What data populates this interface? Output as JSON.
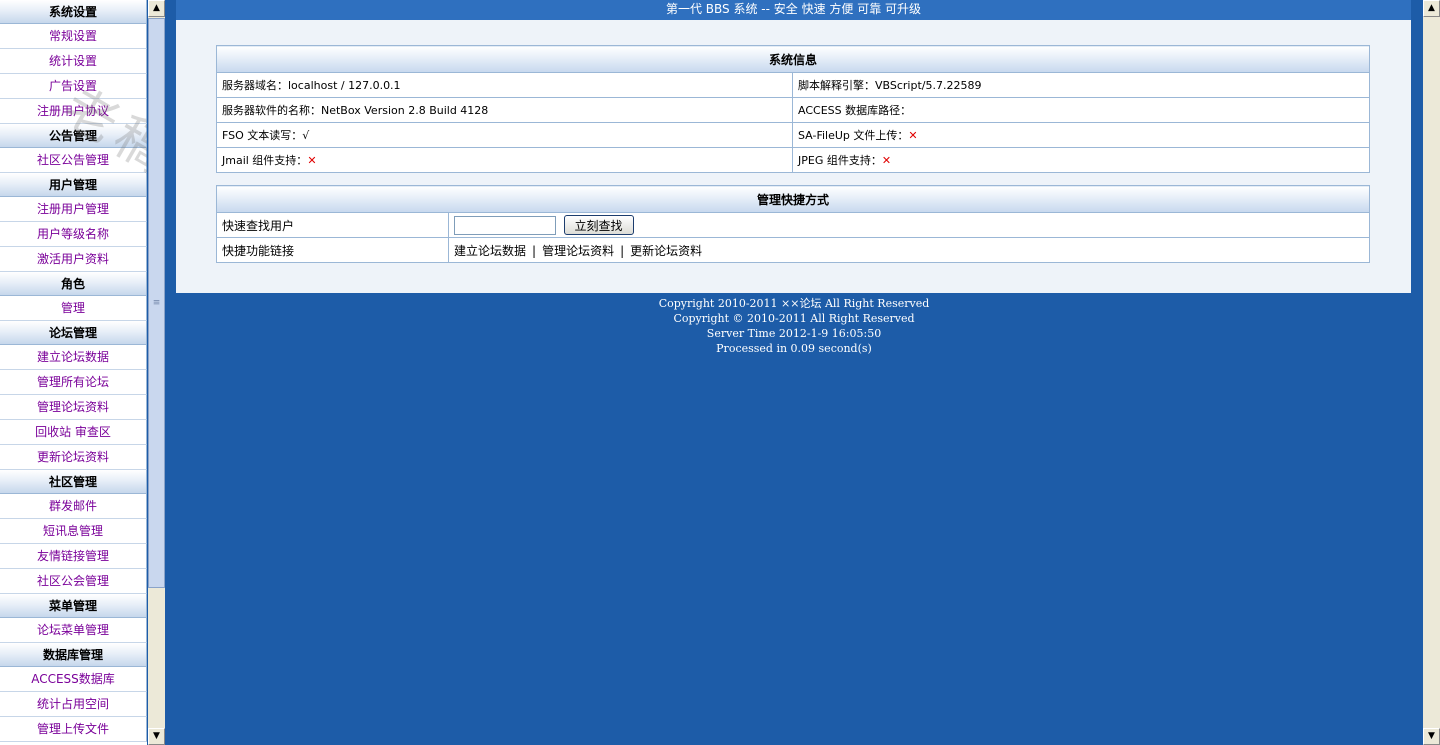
{
  "sidebar": {
    "sections": [
      {
        "title": "系统设置",
        "items": [
          "常规设置",
          "统计设置",
          "广告设置",
          "注册用户协议"
        ]
      },
      {
        "title": "公告管理",
        "items": [
          "社区公告管理"
        ]
      },
      {
        "title": "用户管理",
        "items": [
          "注册用户管理",
          "用户等级名称",
          "激活用户资料"
        ]
      },
      {
        "title": "角色",
        "items": [
          "管理"
        ]
      },
      {
        "title": "论坛管理",
        "items": [
          "建立论坛数据",
          "管理所有论坛",
          "管理论坛资料",
          "回收站 审查区",
          "更新论坛资料"
        ]
      },
      {
        "title": "社区管理",
        "items": [
          "群发邮件",
          "短讯息管理",
          "友情链接管理",
          "社区公会管理"
        ]
      },
      {
        "title": "菜单管理",
        "items": [
          "论坛菜单管理"
        ]
      },
      {
        "title": "数据库管理",
        "items": [
          "ACCESS数据库",
          "统计占用空间",
          "管理上传文件"
        ]
      }
    ]
  },
  "header": {
    "title": "第一代 BBS 系统 -- 安全 快速 方便 可靠 可升级"
  },
  "sysinfo": {
    "title": "系统信息",
    "rows": [
      {
        "left_label": "服务器域名：",
        "left_value": "localhost / 127.0.0.1",
        "right_label": "脚本解释引擎：",
        "right_value": "VBScript/5.7.22589"
      },
      {
        "left_label": "服务器软件的名称：",
        "left_value": "NetBox Version 2.8 Build 4128",
        "right_label": "ACCESS 数据库路径：",
        "right_value": ""
      },
      {
        "left_label": "FSO 文本读写：",
        "left_value": "√",
        "right_label": "SA-FileUp 文件上传：",
        "right_value": "✕"
      },
      {
        "left_label": "Jmail 组件支持：",
        "left_value": "✕",
        "right_label": "JPEG 组件支持：",
        "right_value": "✕"
      }
    ]
  },
  "shortcut": {
    "title": "管理快捷方式",
    "search_label": "快速查找用户",
    "search_value": "",
    "search_button": "立刻查找",
    "links_label": "快捷功能链接",
    "links": [
      "建立论坛数据",
      "管理论坛资料",
      "更新论坛资料"
    ],
    "link_separator": "|"
  },
  "footer": {
    "line1": "Copyright 2010-2011 ××论坛 All Right Reserved",
    "line2": "Copyright © 2010-2011 All Right Reserved",
    "line3": "Server Time 2012-1-9 16:05:50",
    "line4": "Processed in 0.09 second(s)"
  },
  "watermark": {
    "text": "老稿网网络"
  },
  "icons": {
    "scroll_up": "scroll-up-arrow-icon",
    "scroll_down": "scroll-down-arrow-icon",
    "error": "red-x-icon",
    "ok": "check-icon"
  },
  "colors": {
    "background": "#1d5ca8",
    "nav_link": "#7a0099",
    "error": "#e00000"
  }
}
